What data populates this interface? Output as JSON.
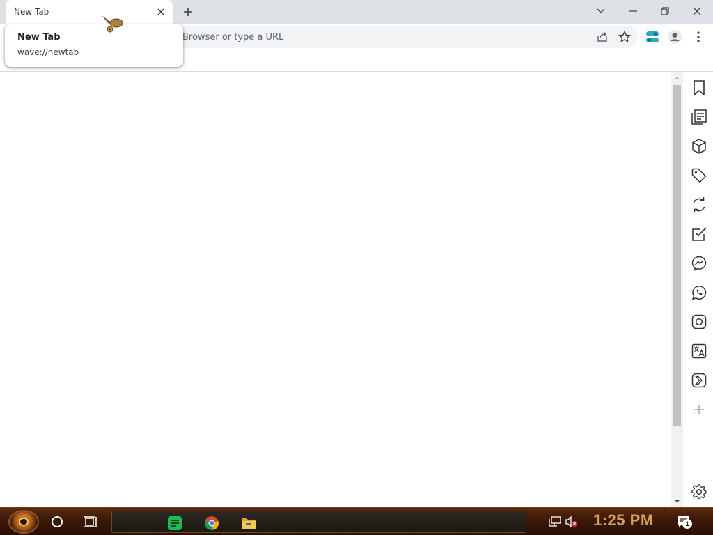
{
  "tab": {
    "title": "New Tab"
  },
  "hover_card": {
    "title": "New Tab",
    "url": "wave://newtab"
  },
  "omnibox": {
    "placeholder": "Browser or type a URL"
  },
  "taskbar": {
    "clock": "1:25 PM",
    "notification_count": "1"
  },
  "colors": {
    "tabstrip": "#dee1e6",
    "omnibox": "#f1f3f4",
    "clock": "#d4a050",
    "spotify_green": "#1db954"
  },
  "sidebar": {
    "icons": [
      "bookmark-icon",
      "reading-list-icon",
      "box-icon",
      "tag-icon",
      "sync-icon",
      "checklist-icon",
      "messenger-icon",
      "whatsapp-icon",
      "instagram-icon",
      "translate-icon",
      "chevron-app-icon",
      "add-icon",
      "settings-icon"
    ]
  }
}
